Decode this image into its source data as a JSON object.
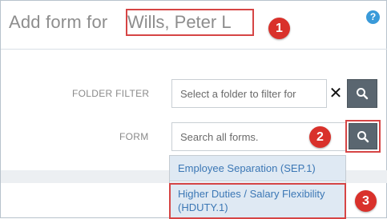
{
  "header": {
    "title_prefix": "Add form for",
    "title_name": "Wills, Peter L",
    "help_icon": "help-icon",
    "help_glyph": "?"
  },
  "folder_filter": {
    "label": "FOLDER FILTER",
    "placeholder": "Select a folder to filter for",
    "clear_glyph": "✕"
  },
  "form": {
    "label": "FORM",
    "placeholder": "Search all forms."
  },
  "dropdown": {
    "items": [
      {
        "label": "Employee Separation (SEP.1)"
      },
      {
        "label": "Higher Duties / Salary Flexibility (HDUTY.1)"
      }
    ]
  },
  "callouts": [
    "1",
    "2",
    "3"
  ],
  "colors": {
    "callout": "#d9312b",
    "highlight": "#d64545",
    "link": "#3b77b5",
    "search_button": "#5a6670"
  }
}
